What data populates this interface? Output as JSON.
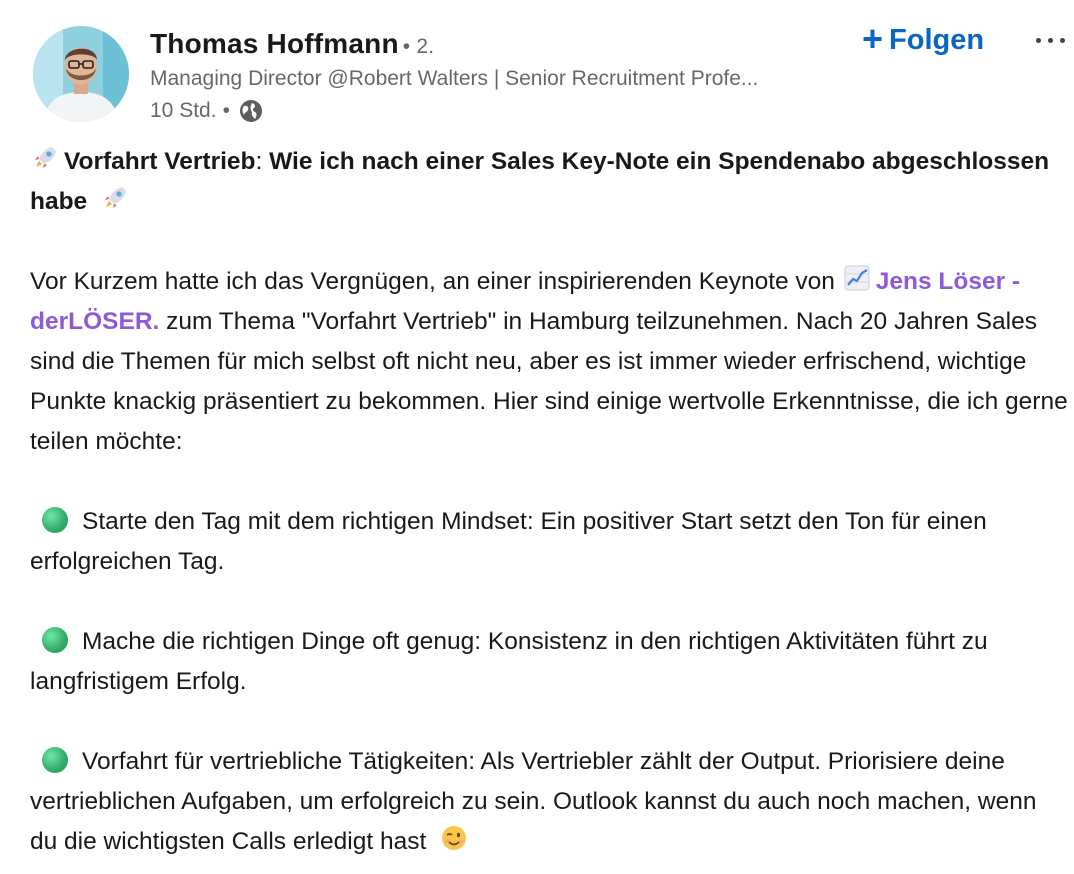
{
  "author": {
    "name": "Thomas Hoffmann",
    "degree": "• 2.",
    "headline": "Managing Director @Robert Walters | Senior Recruitment Profe...",
    "time": "10 Std.",
    "time_separator": "•",
    "visibility_icon": "globe-icon"
  },
  "actions": {
    "follow_label": "Folgen",
    "follow_icon": "plus-icon",
    "more_icon": "more-dots-icon"
  },
  "post": {
    "title_lead": "Vorfahrt Vertrieb",
    "title_colon": ":",
    "title_rest": " Wie ich nach einer Sales Key-Note ein Spendenabo abgeschlossen habe",
    "intro_before": " Vor Kurzem hatte ich das Vergnügen, an einer inspirierenden Keynote von ",
    "mention": "Jens Löser - derLÖSER.",
    "intro_after": " zum Thema \"Vorfahrt Vertrieb\" in Hamburg teilzunehmen. Nach 20 Jahren Sales sind die Themen für mich selbst oft nicht neu, aber es ist immer wieder erfrischend, wichtige Punkte knackig präsentiert zu bekommen. Hier sind einige wertvolle Erkenntnisse, die ich gerne teilen möchte:",
    "bullet_1": "Starte den Tag mit dem richtigen Mindset: Ein positiver Start setzt den Ton für einen erfolgreichen Tag.",
    "bullet_2": "Mache die richtigen Dinge oft genug: Konsistenz in den richtigen Aktivitäten führt zu langfristigem Erfolg.",
    "bullet_3": "Vorfahrt für vertriebliche Tätigkeiten: Als Vertriebler zählt der Output. Priorisiere deine vertrieblichen Aufgaben, um erfolgreich zu sein. Outlook kannst du auch noch machen, wenn du die wichtigsten Calls erledigt hast",
    "icons": [
      "rocket-emoji",
      "chart-increasing-emoji",
      "green-circle-emoji",
      "winking-face-emoji"
    ]
  },
  "colors": {
    "accent": "#0a66c2",
    "mention": "#8f5ad8",
    "bullet": "#3cb371"
  }
}
